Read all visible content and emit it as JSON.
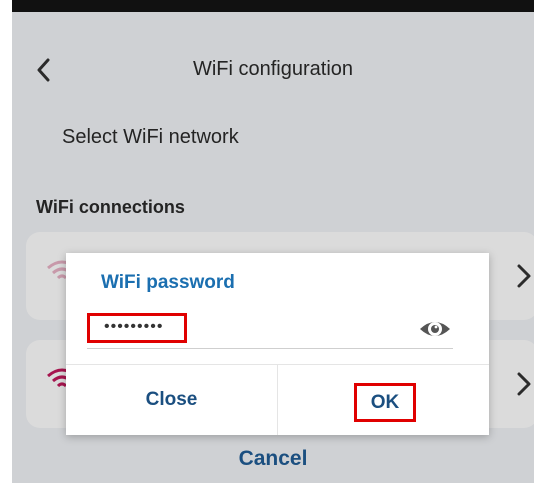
{
  "header": {
    "title": "WiFi configuration"
  },
  "select_network": "Select WiFi network",
  "section_title": "WiFi connections",
  "dialog": {
    "title": "WiFi password",
    "password_value": "•••••••••",
    "close_label": "Close",
    "ok_label": "OK"
  },
  "footer": {
    "cancel_label": "Cancel"
  },
  "colors": {
    "accent": "#1b6fb0",
    "button_text": "#1b4f80",
    "highlight": "#e00000",
    "wifi_icon": "#c2185b"
  },
  "icons": [
    "chevron-left-icon",
    "wifi-icon",
    "chevron-right-icon",
    "eye-icon"
  ]
}
